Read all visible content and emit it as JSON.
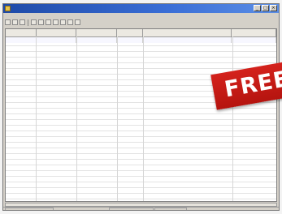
{
  "window": {
    "title": ""
  },
  "promo": {
    "text": "FREE"
  },
  "colors": {
    "titlebar": "#1e4aa8",
    "banner": "#d4221c"
  }
}
